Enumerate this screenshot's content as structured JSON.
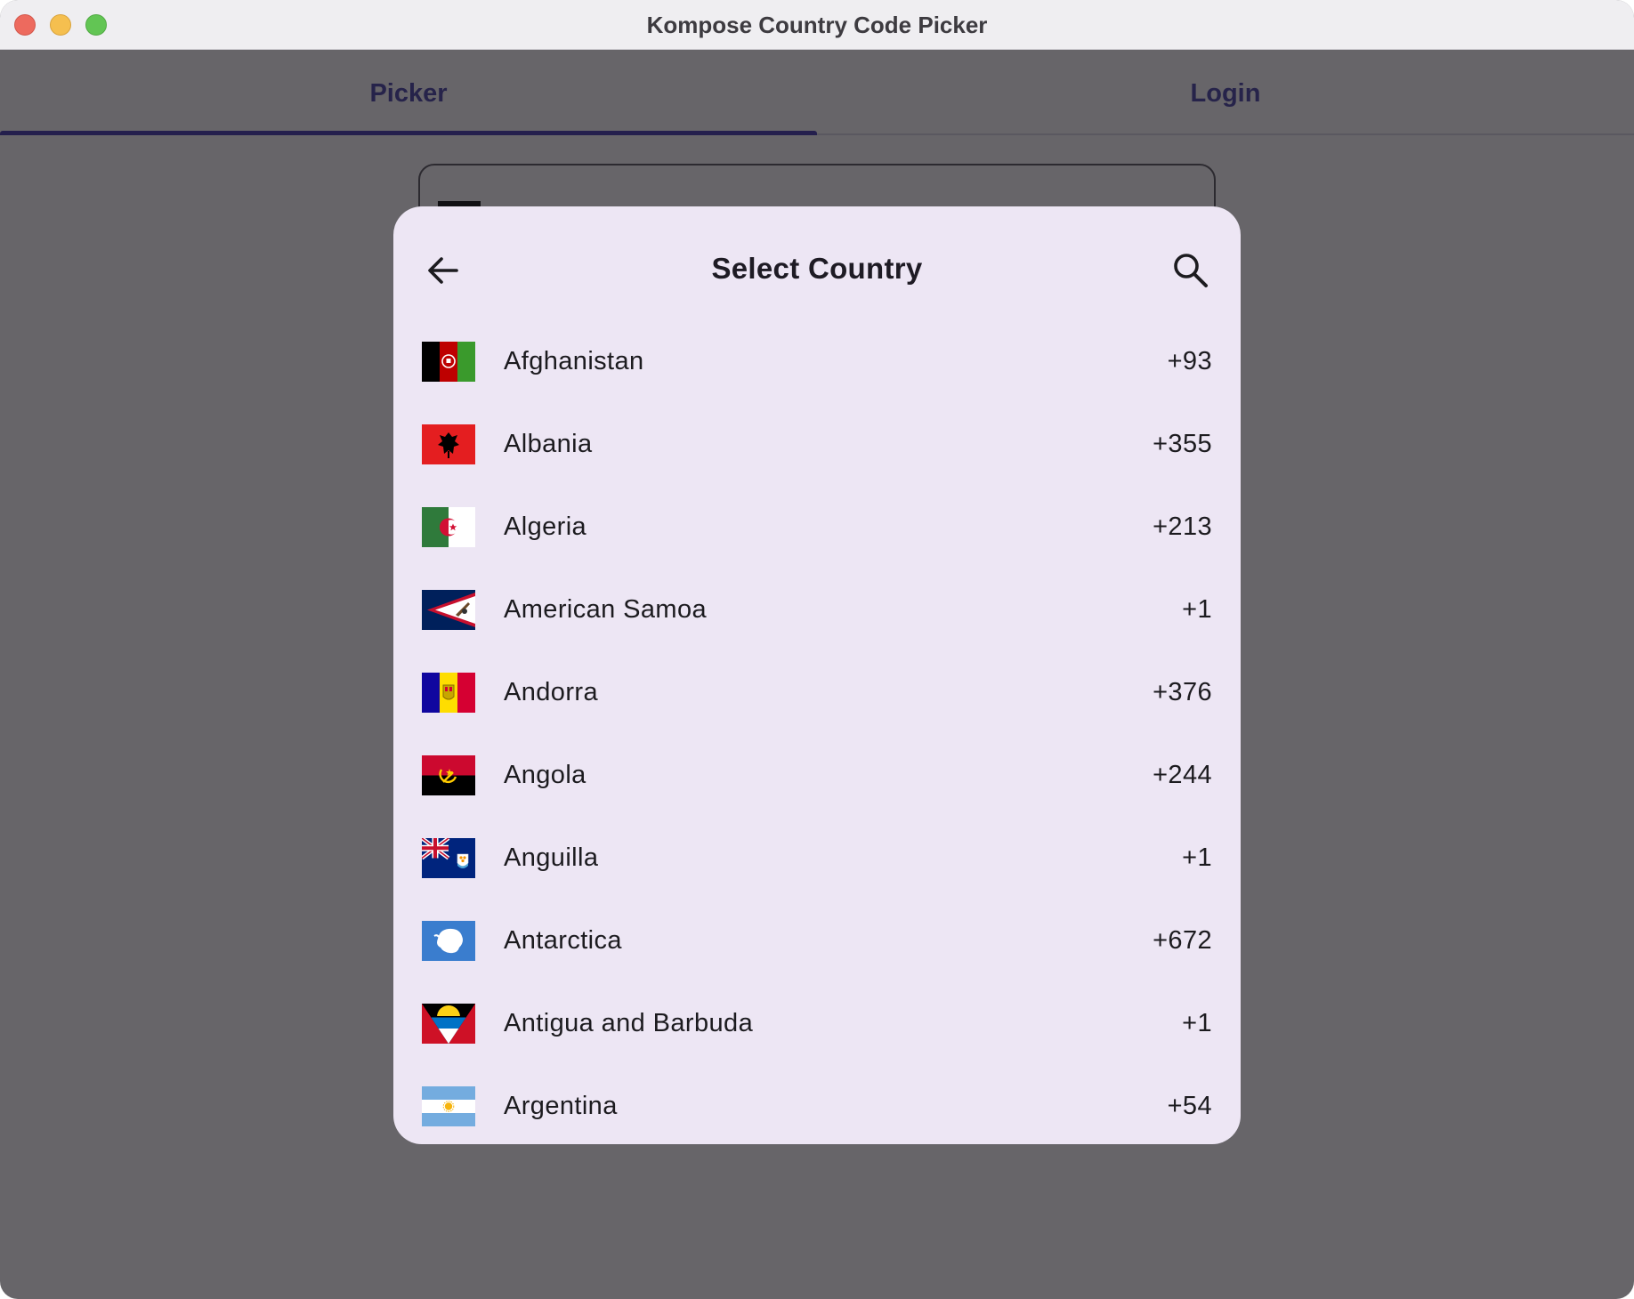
{
  "window": {
    "title": "Kompose Country Code Picker"
  },
  "tabs": [
    {
      "label": "Picker",
      "selected": true
    },
    {
      "label": "Login",
      "selected": false
    }
  ],
  "dialog": {
    "title": "Select Country",
    "back_icon": "arrow-back-icon",
    "search_icon": "search-icon"
  },
  "countries": [
    {
      "name": "Afghanistan",
      "code": "+93"
    },
    {
      "name": "Albania",
      "code": "+355"
    },
    {
      "name": "Algeria",
      "code": "+213"
    },
    {
      "name": "American Samoa",
      "code": "+1"
    },
    {
      "name": "Andorra",
      "code": "+376"
    },
    {
      "name": "Angola",
      "code": "+244"
    },
    {
      "name": "Anguilla",
      "code": "+1"
    },
    {
      "name": "Antarctica",
      "code": "+672"
    },
    {
      "name": "Antigua and Barbuda",
      "code": "+1"
    },
    {
      "name": "Argentina",
      "code": "+54"
    }
  ],
  "colors": {
    "scrim": "#676569",
    "dialog_bg": "#ede6f4",
    "tab_text": "#26234a",
    "tab_indicator": "#241f4d"
  }
}
